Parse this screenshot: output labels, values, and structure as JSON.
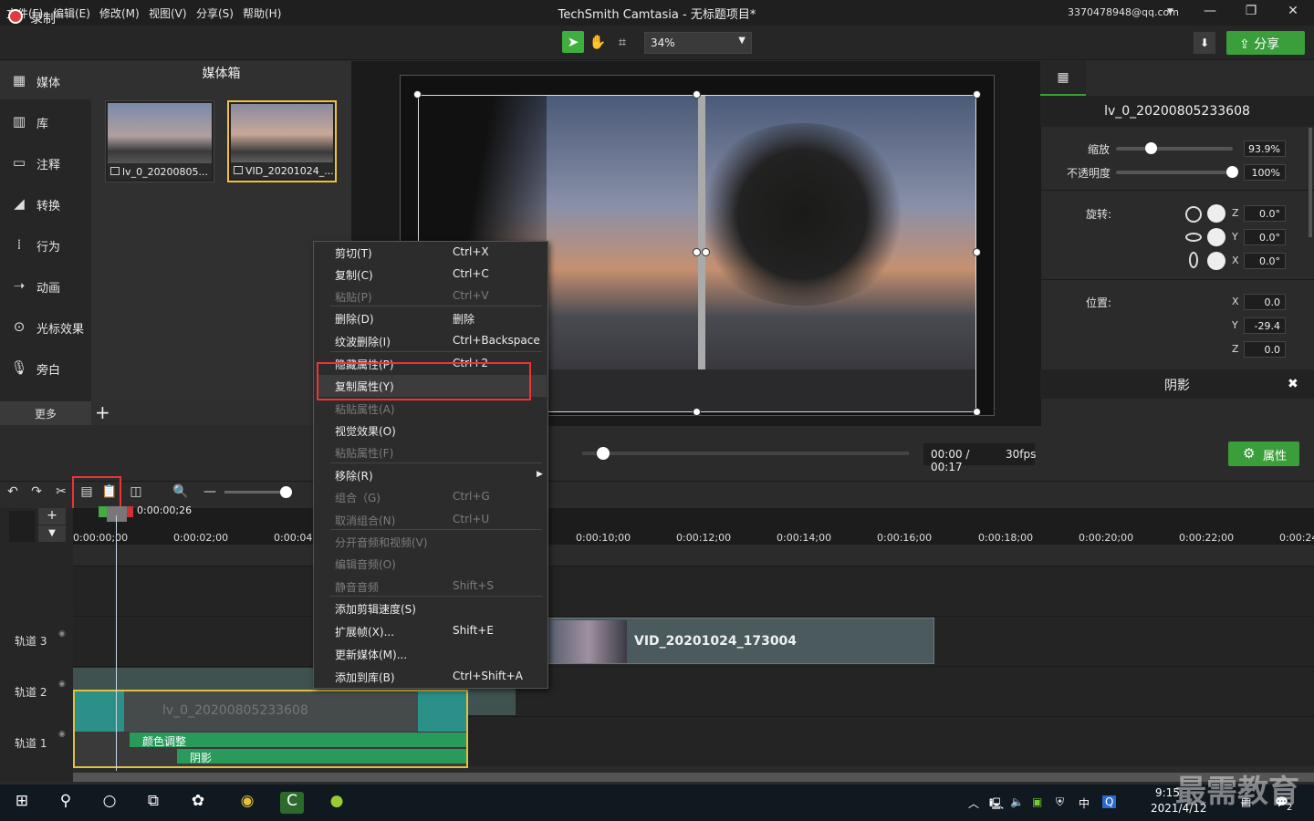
{
  "menubar": {
    "items": [
      "文件(F)",
      "编辑(E)",
      "修改(M)",
      "视图(V)",
      "分享(S)",
      "帮助(H)"
    ],
    "title": "TechSmith Camtasia - 无标题项目*",
    "account": "3370478948@qq.com"
  },
  "toolbar": {
    "record_label": "录制",
    "zoom": "34%",
    "share_label": "分享"
  },
  "sidebar": {
    "items": [
      {
        "label": "媒体",
        "icon": "film-icon"
      },
      {
        "label": "库",
        "icon": "library-icon"
      },
      {
        "label": "注释",
        "icon": "annotation-icon"
      },
      {
        "label": "转换",
        "icon": "transition-icon"
      },
      {
        "label": "行为",
        "icon": "behavior-icon"
      },
      {
        "label": "动画",
        "icon": "animation-icon"
      },
      {
        "label": "光标效果",
        "icon": "cursor-icon"
      },
      {
        "label": "旁白",
        "icon": "microphone-icon"
      }
    ],
    "more_label": "更多"
  },
  "mediabin": {
    "title": "媒体箱",
    "items": [
      {
        "caption": "lv_0_20200805..."
      },
      {
        "caption": "VID_20201024_..."
      }
    ]
  },
  "context_menu": {
    "items": [
      {
        "label": "剪切(T)",
        "shortcut": "Ctrl+X",
        "enabled": true
      },
      {
        "label": "复制(C)",
        "shortcut": "Ctrl+C",
        "enabled": true
      },
      {
        "label": "粘贴(P)",
        "shortcut": "Ctrl+V",
        "enabled": false
      },
      {
        "label": "删除(D)",
        "shortcut": "删除",
        "enabled": true
      },
      {
        "label": "纹波删除(I)",
        "shortcut": "Ctrl+Backspace",
        "enabled": true
      },
      {
        "label": "隐藏属性(P)",
        "shortcut": "Ctrl+2",
        "enabled": true
      },
      {
        "label": "复制属性(Y)",
        "shortcut": "",
        "enabled": true
      },
      {
        "label": "粘贴属性(A)",
        "shortcut": "",
        "enabled": false
      },
      {
        "label": "视觉效果(O)",
        "shortcut": "",
        "enabled": true
      },
      {
        "label": "粘贴属性(F)",
        "shortcut": "",
        "enabled": false
      },
      {
        "label": "移除(R)",
        "shortcut": "",
        "enabled": true
      },
      {
        "label": "组合（G)",
        "shortcut": "Ctrl+G",
        "enabled": false
      },
      {
        "label": "取消组合(N)",
        "shortcut": "Ctrl+U",
        "enabled": false
      },
      {
        "label": "分开音频和视频(V)",
        "shortcut": "",
        "enabled": false
      },
      {
        "label": "编辑音频(O)",
        "shortcut": "",
        "enabled": false
      },
      {
        "label": "静音音频",
        "shortcut": "Shift+S",
        "enabled": false
      },
      {
        "label": "添加剪辑速度(S)",
        "shortcut": "",
        "enabled": true
      },
      {
        "label": "扩展帧(X)...",
        "shortcut": "Shift+E",
        "enabled": true
      },
      {
        "label": "更新媒体(M)...",
        "shortcut": "",
        "enabled": true
      },
      {
        "label": "添加到库(B)",
        "shortcut": "Ctrl+Shift+A",
        "enabled": true
      }
    ]
  },
  "playback": {
    "time": "00:00 / 00:17",
    "fps": "30fps",
    "props_label": "属性"
  },
  "properties": {
    "clip_name": "lv_0_20200805233608",
    "scale_label": "缩放",
    "scale_value": "93.9%",
    "scale_fraction": 0.3,
    "opacity_label": "不透明度",
    "opacity_value": "100%",
    "opacity_fraction": 1.0,
    "rotation_label": "旋转:",
    "rot_z": "0.0°",
    "rot_y": "0.0°",
    "rot_x": "0.0°",
    "position_label": "位置:",
    "pos_x": "0.0",
    "pos_y": "-29.4",
    "pos_z": "0.0",
    "axis_z": "Z",
    "axis_y": "Y",
    "axis_x": "X",
    "shadow_label": "阴影"
  },
  "timeline": {
    "playhead_time": "0:00:00;26",
    "ticks": [
      "0:00:00;00",
      "0:00:02;00",
      "0:00:04;",
      "0:00:10;00",
      "0:00:12;00",
      "0:00:14;00",
      "0:00:16;00",
      "0:00:18;00",
      "0:00:20;00",
      "0:00:22;00",
      "0:00:24"
    ],
    "tracks": [
      "轨道 3",
      "轨道 2",
      "轨道 1"
    ],
    "clip_vid": "VID_20201024_173004",
    "clip_lv": "lv_0_20200805233608",
    "effect_color": "颜色调整",
    "effect_shadow": "阴影"
  },
  "taskbar": {
    "time": "9:15",
    "date": "2021/4/12",
    "ime": "中",
    "notif_count": "2"
  },
  "watermark": "最需教育"
}
